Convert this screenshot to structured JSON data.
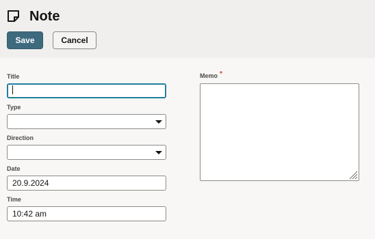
{
  "page": {
    "title": "Note",
    "icon": "note-icon"
  },
  "toolbar": {
    "save_label": "Save",
    "cancel_label": "Cancel"
  },
  "form": {
    "title": {
      "label": "Title",
      "value": ""
    },
    "type": {
      "label": "Type",
      "value": ""
    },
    "direction": {
      "label": "Direction",
      "value": ""
    },
    "date": {
      "label": "Date",
      "value": "20.9.2024"
    },
    "time": {
      "label": "Time",
      "value": "10:42 am"
    },
    "memo": {
      "label": "Memo",
      "required_marker": "*",
      "value": ""
    }
  },
  "colors": {
    "accent": "#3e6a7e",
    "focus": "#227e9e",
    "required": "#c74634",
    "header_bg": "#f1efed",
    "form_bg": "#f8f7f5"
  }
}
